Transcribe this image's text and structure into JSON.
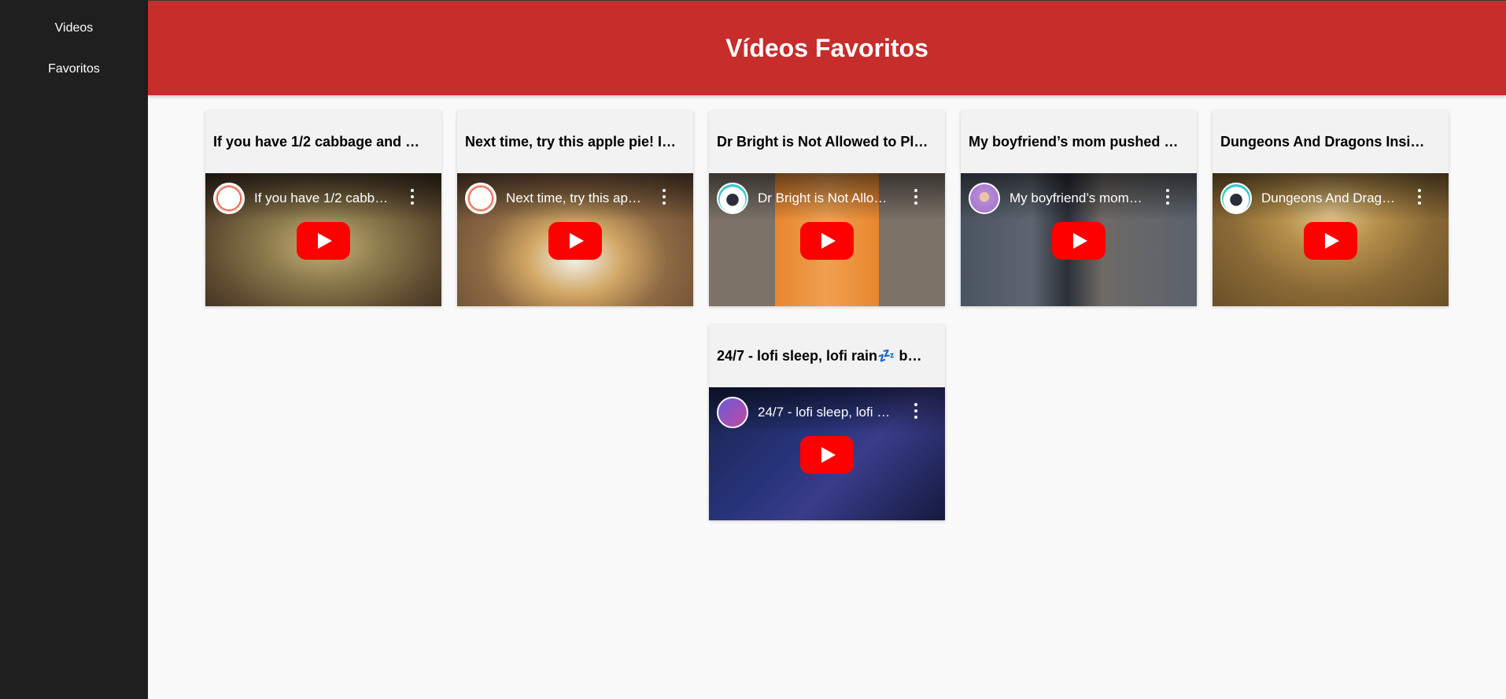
{
  "sidebar": {
    "items": [
      {
        "label": "Videos"
      },
      {
        "label": "Favoritos"
      }
    ]
  },
  "header": {
    "title": "Vídeos Favoritos"
  },
  "colors": {
    "header_bg": "#c62d2b",
    "sidebar_bg": "#1f1f1f",
    "play_button": "#ff0000"
  },
  "videos": [
    {
      "card_title": "If you have 1/2 cabbage and …",
      "player_title": "If you have 1/2 cabb…",
      "avatar_icon": "smiley-channel-icon"
    },
    {
      "card_title": "Next time, try this apple pie! I…",
      "player_title": "Next time, try this ap…",
      "avatar_icon": "smiley-channel-icon"
    },
    {
      "card_title": "Dr Bright is Not Allowed to Pl…",
      "player_title": "Dr Bright is Not Allo…",
      "avatar_icon": "skull-cat-channel-icon"
    },
    {
      "card_title": "My boyfriend’s mom pushed …",
      "player_title": "My boyfriend’s mom…",
      "avatar_icon": "person-channel-icon"
    },
    {
      "card_title": "Dungeons And Dragons Insi…",
      "player_title": "Dungeons And Drag…",
      "avatar_icon": "skull-cat-channel-icon"
    },
    {
      "card_title": "24/7 - lofi sleep, lofi rain💤 b…",
      "player_title": "24/7 - lofi sleep, lofi …",
      "avatar_icon": "mask-channel-icon"
    }
  ]
}
